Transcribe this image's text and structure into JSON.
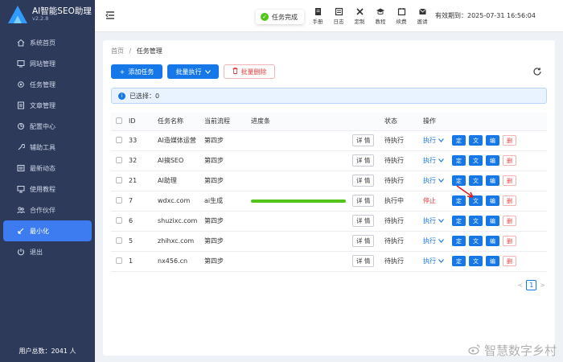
{
  "app": {
    "title": "AI智能SEO助理",
    "version": "v2.2.8"
  },
  "sidebar": {
    "items": [
      {
        "label": "系统首页",
        "icon": "home-icon",
        "active": false
      },
      {
        "label": "网站管理",
        "icon": "globe-icon",
        "active": false
      },
      {
        "label": "任务管理",
        "icon": "gear-icon",
        "active": false
      },
      {
        "label": "文章管理",
        "icon": "document-icon",
        "active": false
      },
      {
        "label": "配置中心",
        "icon": "settings-icon",
        "active": false
      },
      {
        "label": "辅助工具",
        "icon": "wrench-icon",
        "active": false
      },
      {
        "label": "最新动态",
        "icon": "news-icon",
        "active": false
      },
      {
        "label": "使用教程",
        "icon": "monitor-icon",
        "active": false
      },
      {
        "label": "合作伙伴",
        "icon": "partner-icon",
        "active": false
      },
      {
        "label": "最小化",
        "icon": "minimize-icon",
        "active": true
      },
      {
        "label": "退出",
        "icon": "power-icon",
        "active": false
      }
    ],
    "user_total": "用户总数：2041 人"
  },
  "topbar": {
    "toast": "任务完成",
    "tools": [
      {
        "label": "手册",
        "icon": "manual-icon"
      },
      {
        "label": "日志",
        "icon": "log-icon"
      },
      {
        "label": "定制",
        "icon": "customize-icon"
      },
      {
        "label": "教程",
        "icon": "tutorial-icon"
      },
      {
        "label": "续费",
        "icon": "renew-icon"
      },
      {
        "label": "邀请",
        "icon": "invite-icon"
      }
    ],
    "expiry": "有效期到：2025-07-31 16:56:04"
  },
  "main": {
    "breadcrumb": {
      "home": "首页",
      "sep": "/",
      "current": "任务管理"
    },
    "buttons": {
      "add": "添加任务",
      "batch_run": "批量执行",
      "batch_delete": "批量删除"
    },
    "selected": "已选择：0",
    "columns": [
      "ID",
      "任务名称",
      "当前流程",
      "进度条",
      "",
      "状态",
      "操作"
    ],
    "detail_label": "详 情",
    "action_labels": {
      "run": "执行",
      "stop": "停止",
      "schedule": "定",
      "article": "文",
      "edit": "编",
      "delete": "删"
    },
    "rows": [
      {
        "id": "33",
        "name": "AI造媒体运营",
        "step": "第四步",
        "progress": null,
        "status": "待执行",
        "action": "run"
      },
      {
        "id": "32",
        "name": "AI搞SEO",
        "step": "第四步",
        "progress": null,
        "status": "待执行",
        "action": "run"
      },
      {
        "id": "21",
        "name": "AI助理",
        "step": "第四步",
        "progress": null,
        "status": "待执行",
        "action": "run"
      },
      {
        "id": "7",
        "name": "wdxc.com",
        "step": "ai生成",
        "progress": 100,
        "status": "执行中",
        "action": "stop"
      },
      {
        "id": "6",
        "name": "shuzixc.com",
        "step": "第四步",
        "progress": null,
        "status": "待执行",
        "action": "run"
      },
      {
        "id": "5",
        "name": "zhihxc.com",
        "step": "第四步",
        "progress": null,
        "status": "待执行",
        "action": "run"
      },
      {
        "id": "1",
        "name": "nx456.cn",
        "step": "第四步",
        "progress": null,
        "status": "待执行",
        "action": "run"
      }
    ],
    "pager": {
      "prev": "<",
      "page": "1",
      "next": ">"
    }
  },
  "watermark": "智慧数字乡村",
  "colors": {
    "sidebar": "#2d3a5a",
    "accent": "#1677e8",
    "success": "#52c41a",
    "danger": "#e04040"
  }
}
